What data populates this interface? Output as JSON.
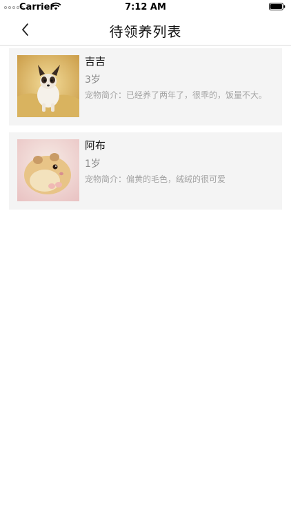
{
  "status_bar": {
    "carrier": "Carrier",
    "time": "7:12 AM"
  },
  "nav": {
    "title": "待领养列表",
    "back_icon": "chevron-left-icon"
  },
  "pets": [
    {
      "name": "吉吉",
      "age": "3岁",
      "description": "宠物简介：已经养了两年了，很乖的，饭量不大。",
      "photo": "chihuahua-puppy-photo"
    },
    {
      "name": "阿布",
      "age": "1岁",
      "description": "宠物简介：偏黄的毛色，绒绒的很可爱",
      "photo": "hamster-photo"
    }
  ]
}
